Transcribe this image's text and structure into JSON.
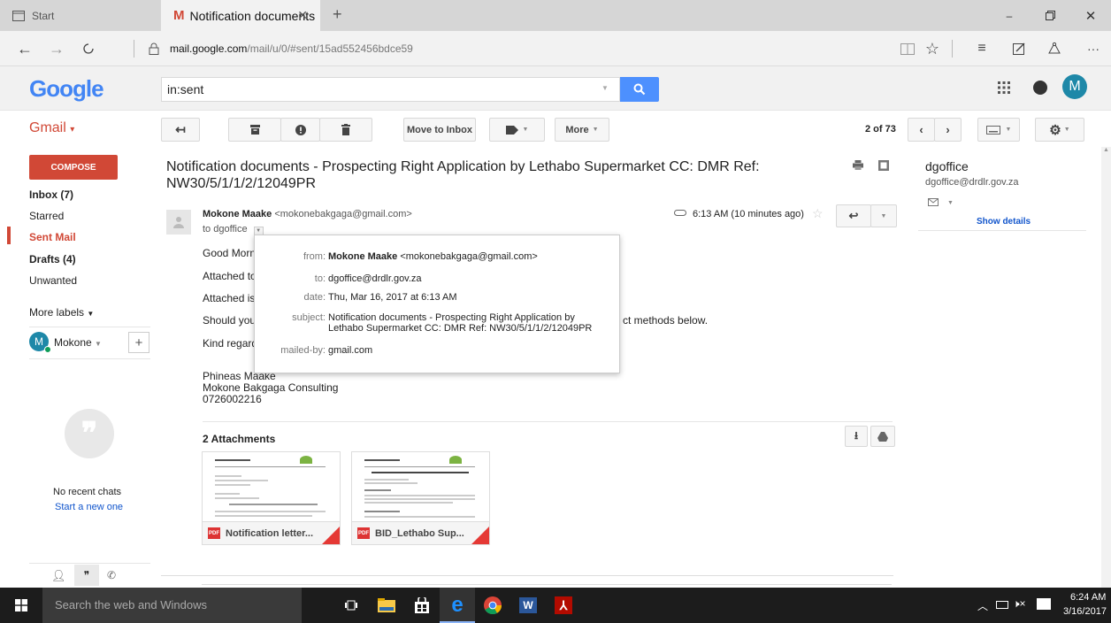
{
  "browser": {
    "tabs": [
      {
        "label": "Start"
      },
      {
        "label": "Notification documents"
      }
    ],
    "url_host": "mail.google.com",
    "url_path": "/mail/u/0/#sent/15ad552456bdce59"
  },
  "header": {
    "logo": "Google",
    "search_value": "in:sent",
    "avatar_letter": "M"
  },
  "toolbar": {
    "gmail_label": "Gmail",
    "move_to_inbox": "Move to Inbox",
    "more": "More",
    "pagination": "2 of 73"
  },
  "sidebar": {
    "compose": "COMPOSE",
    "items": [
      {
        "label": "Inbox (7)"
      },
      {
        "label": "Starred"
      },
      {
        "label": "Sent Mail"
      },
      {
        "label": "Drafts (4)"
      },
      {
        "label": "Unwanted"
      }
    ],
    "more_labels": "More labels",
    "user": "Mokone",
    "user_initial": "M",
    "no_chats": "No recent chats",
    "start_new": "Start a new one"
  },
  "message": {
    "subject": "Notification documents - Prospecting Right Application by Lethabo Supermarket CC: DMR Ref: NW30/5/1/1/2/12049PR",
    "sender_name": "Mokone Maake",
    "sender_email": "<mokonebakgaga@gmail.com>",
    "to_line": "to dgoffice",
    "time": "6:13 AM (10 minutes ago)",
    "body": [
      "Good Morni",
      "Attached to",
      "Attached is",
      "Should you",
      "ct methods below.",
      "Kind regard"
    ],
    "signature": [
      "Phineas Maake",
      "Mokone Bakgaga Consulting",
      "0726002216"
    ],
    "attachments_title": "2 Attachments",
    "attachments": [
      {
        "name": "Notification letter..."
      },
      {
        "name": "BID_Lethabo Sup..."
      }
    ]
  },
  "details_popup": {
    "from_label": "from:",
    "from_name": "Mokone Maake",
    "from_email": "<mokonebakgaga@gmail.com>",
    "to_label": "to:",
    "to_value": "dgoffice@drdlr.gov.za",
    "date_label": "date:",
    "date_value": "Thu, Mar 16, 2017 at 6:13 AM",
    "subject_label": "subject:",
    "subject_line1": "Notification documents - Prospecting Right Application by",
    "subject_line2": "Lethabo Supermarket CC: DMR Ref: NW30/5/1/1/2/12049PR",
    "mailedby_label": "mailed-by:",
    "mailedby_value": "gmail.com"
  },
  "contact_panel": {
    "name": "dgoffice",
    "email": "dgoffice@drdlr.gov.za",
    "show_details": "Show details"
  },
  "taskbar": {
    "search_placeholder": "Search the web and Windows",
    "time": "6:24 AM",
    "date": "3/16/2017"
  },
  "colors": {
    "gmail_red": "#d14836",
    "google_blue": "#4285f4",
    "search_button": "#4d90fe",
    "avatar_teal": "#1e88a8"
  }
}
